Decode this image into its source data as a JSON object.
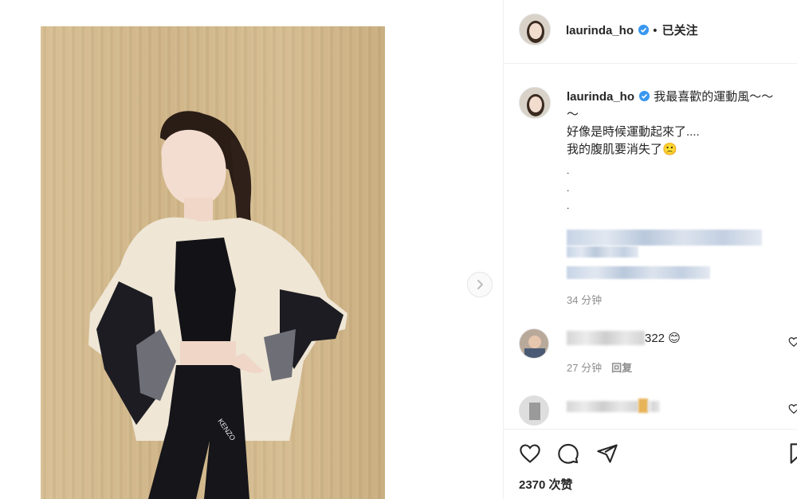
{
  "post": {
    "username": "laurinda_ho",
    "follow_separator": "•",
    "follow_state": "已关注",
    "caption_line1": "我最喜歡的運動風～～",
    "caption_line2": "～",
    "caption_line3": "好像是時候運動起來了....",
    "caption_line4": "我的腹肌要消失了",
    "caption_emoji": "🙁",
    "caption_dots": ".\n.\n.",
    "caption_time": "34 分钟",
    "likes": "2370 次赞"
  },
  "photo": {
    "shirt_print": "KENZO"
  },
  "comments": [
    {
      "text_suffix": "322",
      "emoji": "😊",
      "time": "27 分钟",
      "reply_label": "回复"
    },
    {
      "text_suffix": ""
    }
  ],
  "icons": {
    "verified": "verified-badge-icon",
    "like": "heart-icon",
    "comment": "comment-bubble-icon",
    "share": "paper-plane-icon",
    "save": "bookmark-icon",
    "next": "chevron-right-icon",
    "more": "more-options-icon"
  },
  "colors": {
    "verified_blue": "#3897f0",
    "text": "#262626",
    "muted": "#8e8e8e",
    "border": "#efefef",
    "wall": "#d3b98b"
  }
}
